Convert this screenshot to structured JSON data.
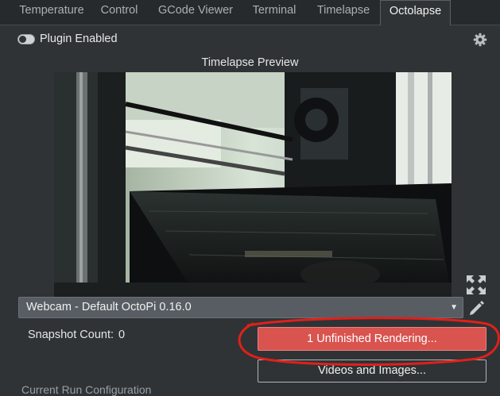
{
  "tabs": [
    {
      "label": "Temperature",
      "active": false
    },
    {
      "label": "Control",
      "active": false
    },
    {
      "label": "GCode Viewer",
      "active": false
    },
    {
      "label": "Terminal",
      "active": false
    },
    {
      "label": "Timelapse",
      "active": false
    },
    {
      "label": "Octolapse",
      "active": true
    }
  ],
  "plugin": {
    "enabled_label": "Plugin Enabled",
    "enabled": true,
    "settings_icon": "gear-icon"
  },
  "preview": {
    "title": "Timelapse Preview"
  },
  "webcam": {
    "selected": "Webcam - Default OctoPi 0.16.0"
  },
  "snapshot": {
    "label": "Snapshot Count:",
    "value": "0"
  },
  "buttons": {
    "unfinished": "1 Unfinished Rendering...",
    "videos": "Videos and Images..."
  },
  "section": {
    "partial_heading": "Current Run Configuration"
  },
  "colors": {
    "accent_red": "#d9534f",
    "annotation_red": "#e0201a",
    "background": "#2f3336"
  }
}
